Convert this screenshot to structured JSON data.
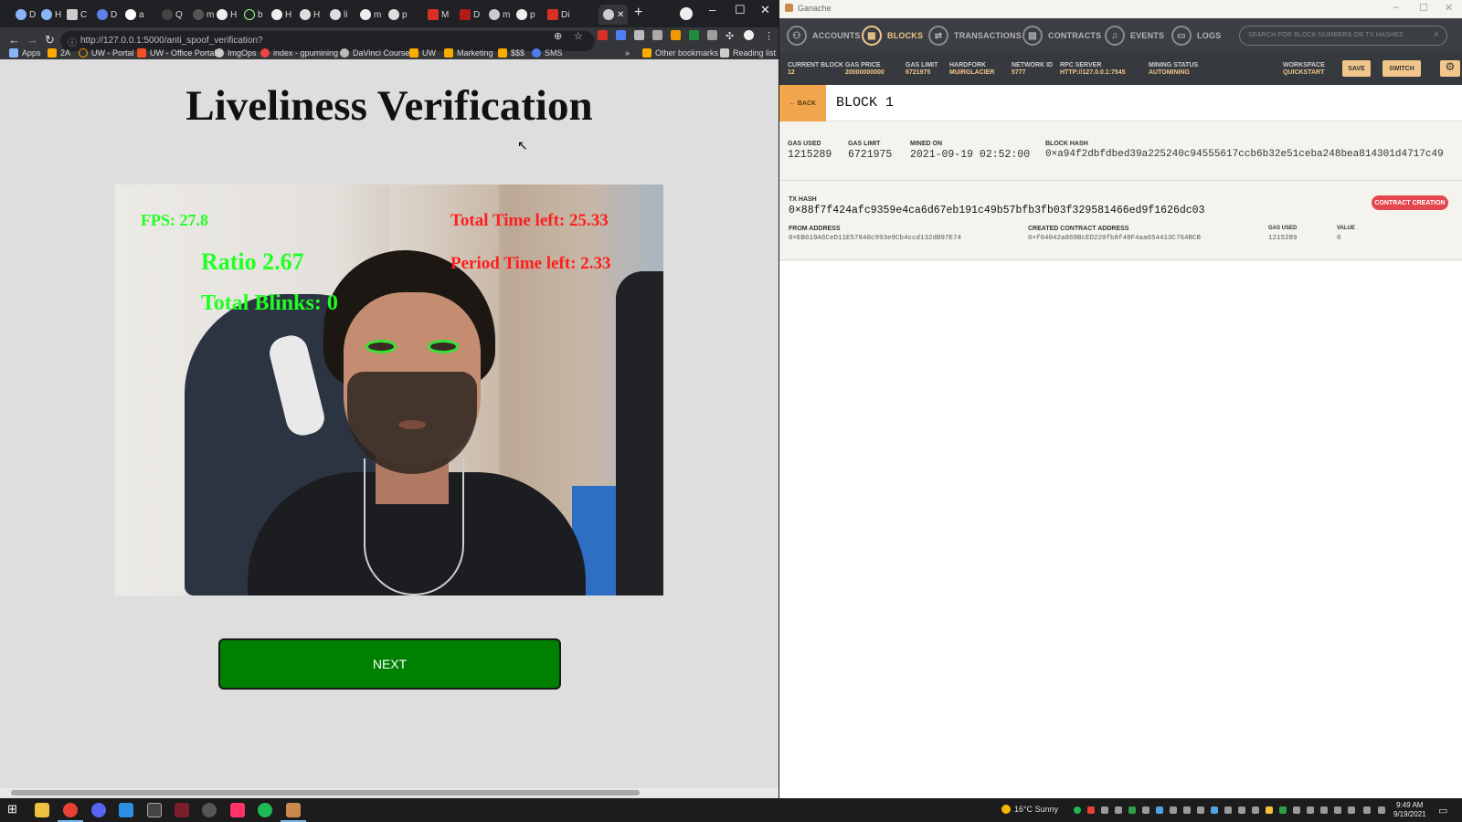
{
  "browser": {
    "tabs": [
      {
        "label": "D"
      },
      {
        "label": "H"
      },
      {
        "label": "C"
      },
      {
        "label": "D"
      },
      {
        "label": "a"
      },
      {
        "label": "Q"
      },
      {
        "label": "m"
      },
      {
        "label": "H"
      },
      {
        "label": "b"
      },
      {
        "label": "H"
      },
      {
        "label": "H"
      },
      {
        "label": "li"
      },
      {
        "label": "m"
      },
      {
        "label": "p"
      },
      {
        "label": "M"
      },
      {
        "label": "D"
      },
      {
        "label": "m"
      },
      {
        "label": "p"
      },
      {
        "label": "Di"
      },
      {
        "label": ""
      }
    ],
    "new_tab_glyph": "+",
    "url": "http://127.0.0.1:5000/anti_spoof_verification?",
    "bookmarks": [
      "Apps",
      "2A",
      "UW - Portal",
      "UW - Office Portal",
      "ImgOps",
      "index - gpumining",
      "DaVinci Course",
      "UW",
      "Marketing",
      "$$$",
      "SMS"
    ],
    "bookmarks_more": "»",
    "other_bookmarks": "Other bookmarks",
    "reading_list": "Reading list",
    "window_controls": {
      "minimize": "–",
      "maximize": "☐",
      "close": "✕"
    }
  },
  "page": {
    "title": "Liveliness Verification",
    "video_overlay": {
      "fps": "FPS: 27.8",
      "ratio": "Ratio 2.67",
      "total_blinks": "Total Blinks: 0",
      "total_time_left": "Total Time left: 25.33",
      "period_time_left": "Period Time left: 2.33",
      "green_color": "#22ff22",
      "red_color": "#ff1e1e"
    },
    "next_button": "NEXT",
    "next_button_color": "#008000"
  },
  "ganache": {
    "app_title": "Ganache",
    "nav": [
      {
        "label": "ACCOUNTS",
        "icon": "accounts-icon"
      },
      {
        "label": "BLOCKS",
        "icon": "blocks-icon"
      },
      {
        "label": "TRANSACTIONS",
        "icon": "transactions-icon"
      },
      {
        "label": "CONTRACTS",
        "icon": "contracts-icon"
      },
      {
        "label": "EVENTS",
        "icon": "events-icon"
      },
      {
        "label": "LOGS",
        "icon": "logs-icon"
      }
    ],
    "active_nav": "BLOCKS",
    "search_placeholder": "SEARCH FOR BLOCK NUMBERS OR TX HASHES",
    "stats": [
      {
        "key": "CURRENT BLOCK",
        "value": "12"
      },
      {
        "key": "GAS PRICE",
        "value": "20000000000"
      },
      {
        "key": "GAS LIMIT",
        "value": "6721975"
      },
      {
        "key": "HARDFORK",
        "value": "MUIRGLACIER"
      },
      {
        "key": "NETWORK ID",
        "value": "5777"
      },
      {
        "key": "RPC SERVER",
        "value": "HTTP://127.0.0.1:7545"
      },
      {
        "key": "MINING STATUS",
        "value": "AUTOMINING"
      }
    ],
    "workspace": {
      "key": "WORKSPACE",
      "value": "QUICKSTART"
    },
    "save_label": "SAVE",
    "switch_label": "SWITCH",
    "accent_color": "#f0c68a",
    "back_label": "← BACK",
    "block_title": "BLOCK 1",
    "block": {
      "gas_used_key": "GAS USED",
      "gas_used": "1215289",
      "gas_limit_key": "GAS LIMIT",
      "gas_limit": "6721975",
      "mined_on_key": "MINED ON",
      "mined_on": "2021-09-19 02:52:00",
      "block_hash_key": "BLOCK HASH",
      "block_hash": "0×a94f2dbfdbed39a225240c94555617ccb6b32e51ceba248bea814301d4717c49"
    },
    "tx": {
      "hash_key": "TX HASH",
      "hash": "0×88f7f424afc9359e4ca6d67eb191c49b57bfb3fb03f329581466ed9f1626dc03",
      "badge": "CONTRACT CREATION",
      "from_key": "FROM ADDRESS",
      "from": "0×EB619A6CeD11E57840c993e9Cb4ccd132dB97E74",
      "created_key": "CREATED CONTRACT ADDRESS",
      "created": "0×f04042a869BcED220fb8f48F4aa654413C764BCB",
      "gas_used_key": "GAS USED",
      "gas_used": "1215289",
      "value_key": "VALUE",
      "value": "0"
    }
  },
  "taskbar": {
    "weather": "16°C  Sunny",
    "time": "9:49 AM",
    "date": "9/19/2021"
  }
}
